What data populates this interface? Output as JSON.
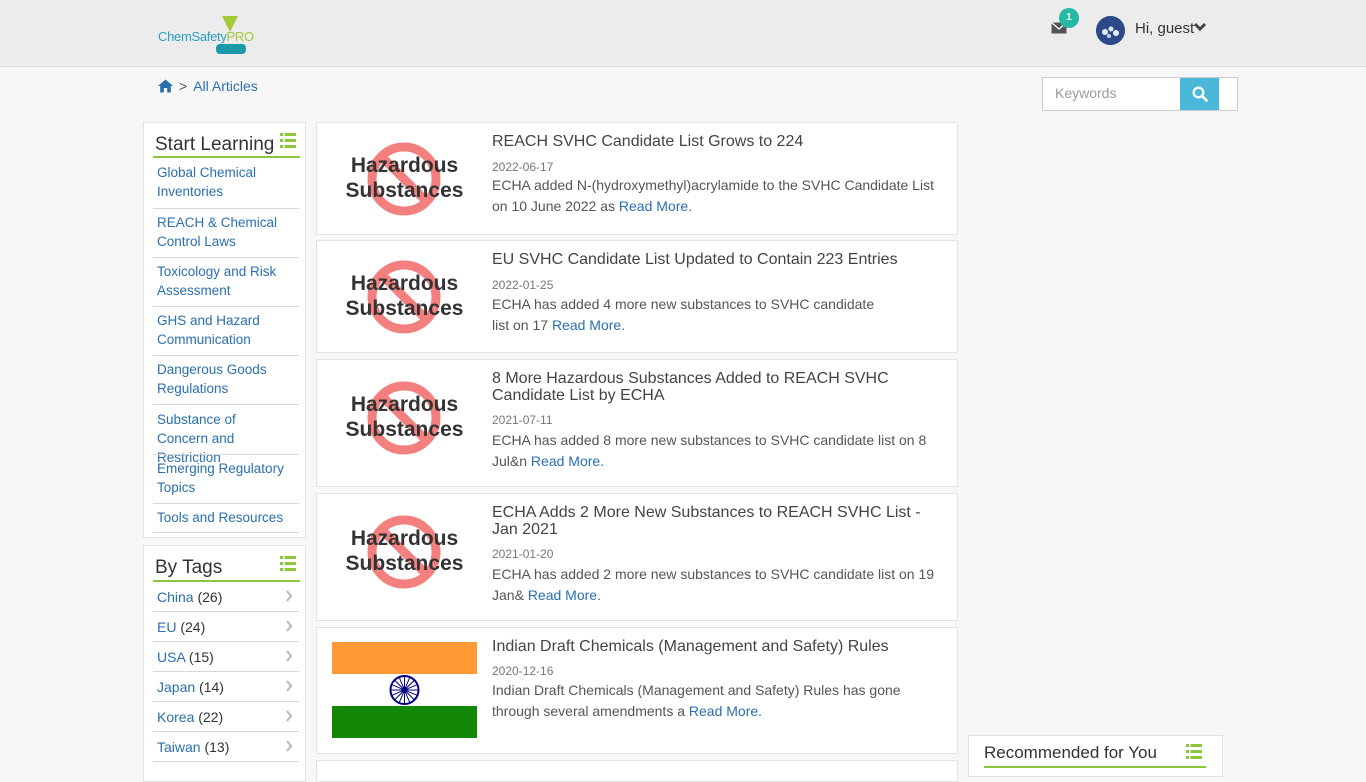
{
  "header": {
    "logo": {
      "part1": "ChemSafety",
      "part2": "PRO"
    },
    "mail_badge": "1",
    "greeting": "Hi, guest"
  },
  "breadcrumb": {
    "separator": ">",
    "current": "All Articles"
  },
  "search": {
    "placeholder": "Keywords"
  },
  "sidebar": {
    "start_learning": {
      "title": "Start Learning",
      "items": [
        {
          "label": "Global Chemical Inventories"
        },
        {
          "label": "REACH & Chemical Control Laws"
        },
        {
          "label": "Toxicology and Risk Assessment"
        },
        {
          "label": "GHS and Hazard Communication"
        },
        {
          "label": "Dangerous Goods Regulations"
        },
        {
          "label": "Substance of Concern and Restriction"
        },
        {
          "label": "Emerging Regulatory Topics"
        },
        {
          "label": "Tools and Resources"
        }
      ]
    },
    "by_tags": {
      "title": "By Tags",
      "items": [
        {
          "name": "China",
          "count": "(26)"
        },
        {
          "name": "EU",
          "count": "(24)"
        },
        {
          "name": "USA",
          "count": "(15)"
        },
        {
          "name": "Japan",
          "count": "(14)"
        },
        {
          "name": "Korea",
          "count": "(22)"
        },
        {
          "name": "Taiwan",
          "count": "(13)"
        }
      ]
    }
  },
  "articles": [
    {
      "thumb_line1": "Hazardous",
      "thumb_line2": "Substances",
      "title": "REACH SVHC Candidate List Grows to 224",
      "date": "2022-06-17",
      "summary": "ECHA added N-(hydroxymethyl)acrylamide  to the SVHC Candidate List on 10 June 2022 as",
      "read_more": "Read More."
    },
    {
      "thumb_line1": "Hazardous",
      "thumb_line2": "Substances",
      "title": "EU SVHC Candidate List Updated to Contain 223 Entries",
      "date": "2022-01-25",
      "summary": "ECHA has added 4 more new substances to SVHC candidate list on 17",
      "read_more": "Read More."
    },
    {
      "thumb_line1": "Hazardous",
      "thumb_line2": "Substances",
      "title": "8 More Hazardous Substances Added to REACH SVHC Candidate List by ECHA",
      "date": "2021-07-11",
      "summary": "ECHA has added 8 more new substances to SVHC candidate list on 8 Jul&n",
      "read_more": "Read More."
    },
    {
      "thumb_line1": "Hazardous",
      "thumb_line2": "Substances",
      "title": "ECHA Adds 2 More New Substances to REACH SVHC List - Jan 2021",
      "date": "2021-01-20",
      "summary": "ECHA has added 2 more new substances to SVHC candidate list on 19 Jan&",
      "read_more": "Read More."
    },
    {
      "title": "Indian Draft Chemicals (Management and Safety) Rules",
      "date": "2020-12-16",
      "summary": "Indian Draft Chemicals (Management and Safety) Rules has gone through several amendments a",
      "read_more": "Read More."
    }
  ],
  "recommended": {
    "title": "Recommended for You"
  },
  "colors": {
    "accent_green": "#8cc63f",
    "link_blue": "#2a6fb0",
    "search_button": "#4ab8d8",
    "badge": "#25b8a4"
  }
}
